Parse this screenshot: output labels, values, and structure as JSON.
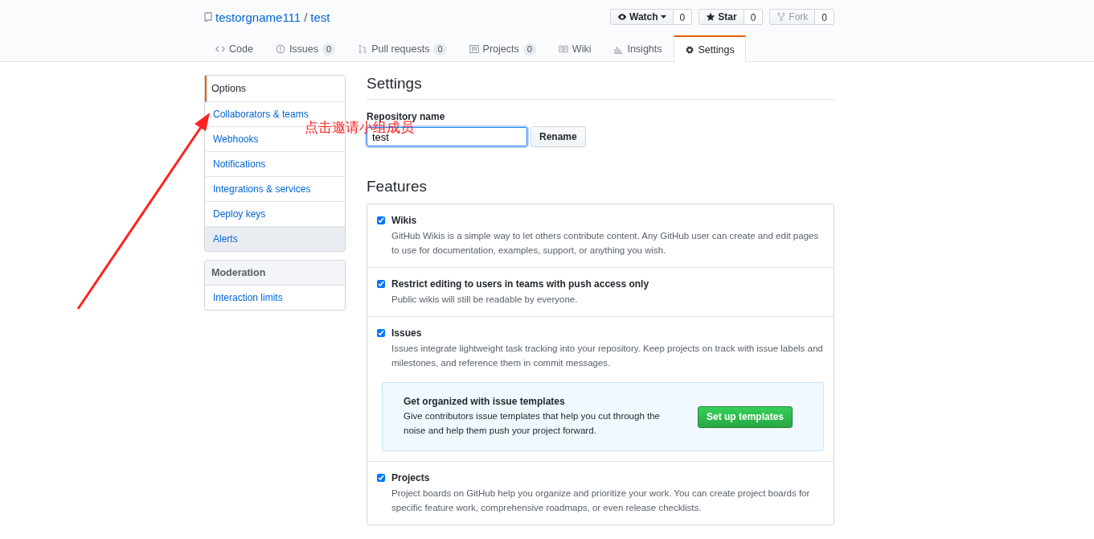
{
  "repo": {
    "owner": "testorgname111",
    "separator": "/",
    "name": "test"
  },
  "actions": [
    {
      "kind": "watch",
      "label": "Watch",
      "count": "0",
      "disabled": false
    },
    {
      "kind": "star",
      "label": "Star",
      "count": "0",
      "disabled": false
    },
    {
      "kind": "fork",
      "label": "Fork",
      "count": "0",
      "disabled": true
    }
  ],
  "tabs": [
    {
      "kind": "code",
      "label": "Code",
      "selected": false
    },
    {
      "kind": "issues",
      "label": "Issues",
      "counter": "0",
      "selected": false
    },
    {
      "kind": "pulls",
      "label": "Pull requests",
      "counter": "0",
      "selected": false
    },
    {
      "kind": "projects",
      "label": "Projects",
      "counter": "0",
      "selected": false
    },
    {
      "kind": "wiki",
      "label": "Wiki",
      "selected": false
    },
    {
      "kind": "insights",
      "label": "Insights",
      "selected": false
    },
    {
      "kind": "settings",
      "label": "Settings",
      "selected": true
    }
  ],
  "sidebar": [
    {
      "items": [
        {
          "label": "Options",
          "selected": true,
          "highlighted": false
        },
        {
          "label": "Collaborators & teams",
          "selected": false,
          "highlighted": false
        },
        {
          "label": "Webhooks",
          "selected": false,
          "highlighted": false
        },
        {
          "label": "Notifications",
          "selected": false,
          "highlighted": false
        },
        {
          "label": "Integrations & services",
          "selected": false,
          "highlighted": false
        },
        {
          "label": "Deploy keys",
          "selected": false,
          "highlighted": false
        },
        {
          "label": "Alerts",
          "selected": false,
          "highlighted": true
        }
      ]
    },
    {
      "heading": "Moderation",
      "items": [
        {
          "label": "Interaction limits",
          "selected": false,
          "highlighted": false
        }
      ]
    }
  ],
  "main": {
    "title": "Settings",
    "repo_name_label": "Repository name",
    "repo_name_value": "test",
    "rename_button": "Rename",
    "features_title": "Features",
    "features": [
      {
        "label": "Wikis",
        "checked": true,
        "description": "GitHub Wikis is a simple way to let others contribute content. Any GitHub user can create and edit pages to use for documentation, examples, support, or anything you wish."
      },
      {
        "label": "Restrict editing to users in teams with push access only",
        "checked": true,
        "description": "Public wikis will still be readable by everyone."
      },
      {
        "label": "Issues",
        "checked": true,
        "description": "Issues integrate lightweight task tracking into your repository. Keep projects on track with issue labels and milestones, and reference them in commit messages.",
        "promo": {
          "title": "Get organized with issue templates",
          "text": "Give contributors issue templates that help you cut through the noise and help them push your project forward.",
          "button": "Set up templates"
        }
      },
      {
        "label": "Projects",
        "checked": true,
        "description": "Project boards on GitHub help you organize and prioritize your work. You can create project boards for specific feature work, comprehensive roadmaps, or even release checklists."
      }
    ]
  },
  "annotation": {
    "text": "点击邀请小组成员"
  }
}
